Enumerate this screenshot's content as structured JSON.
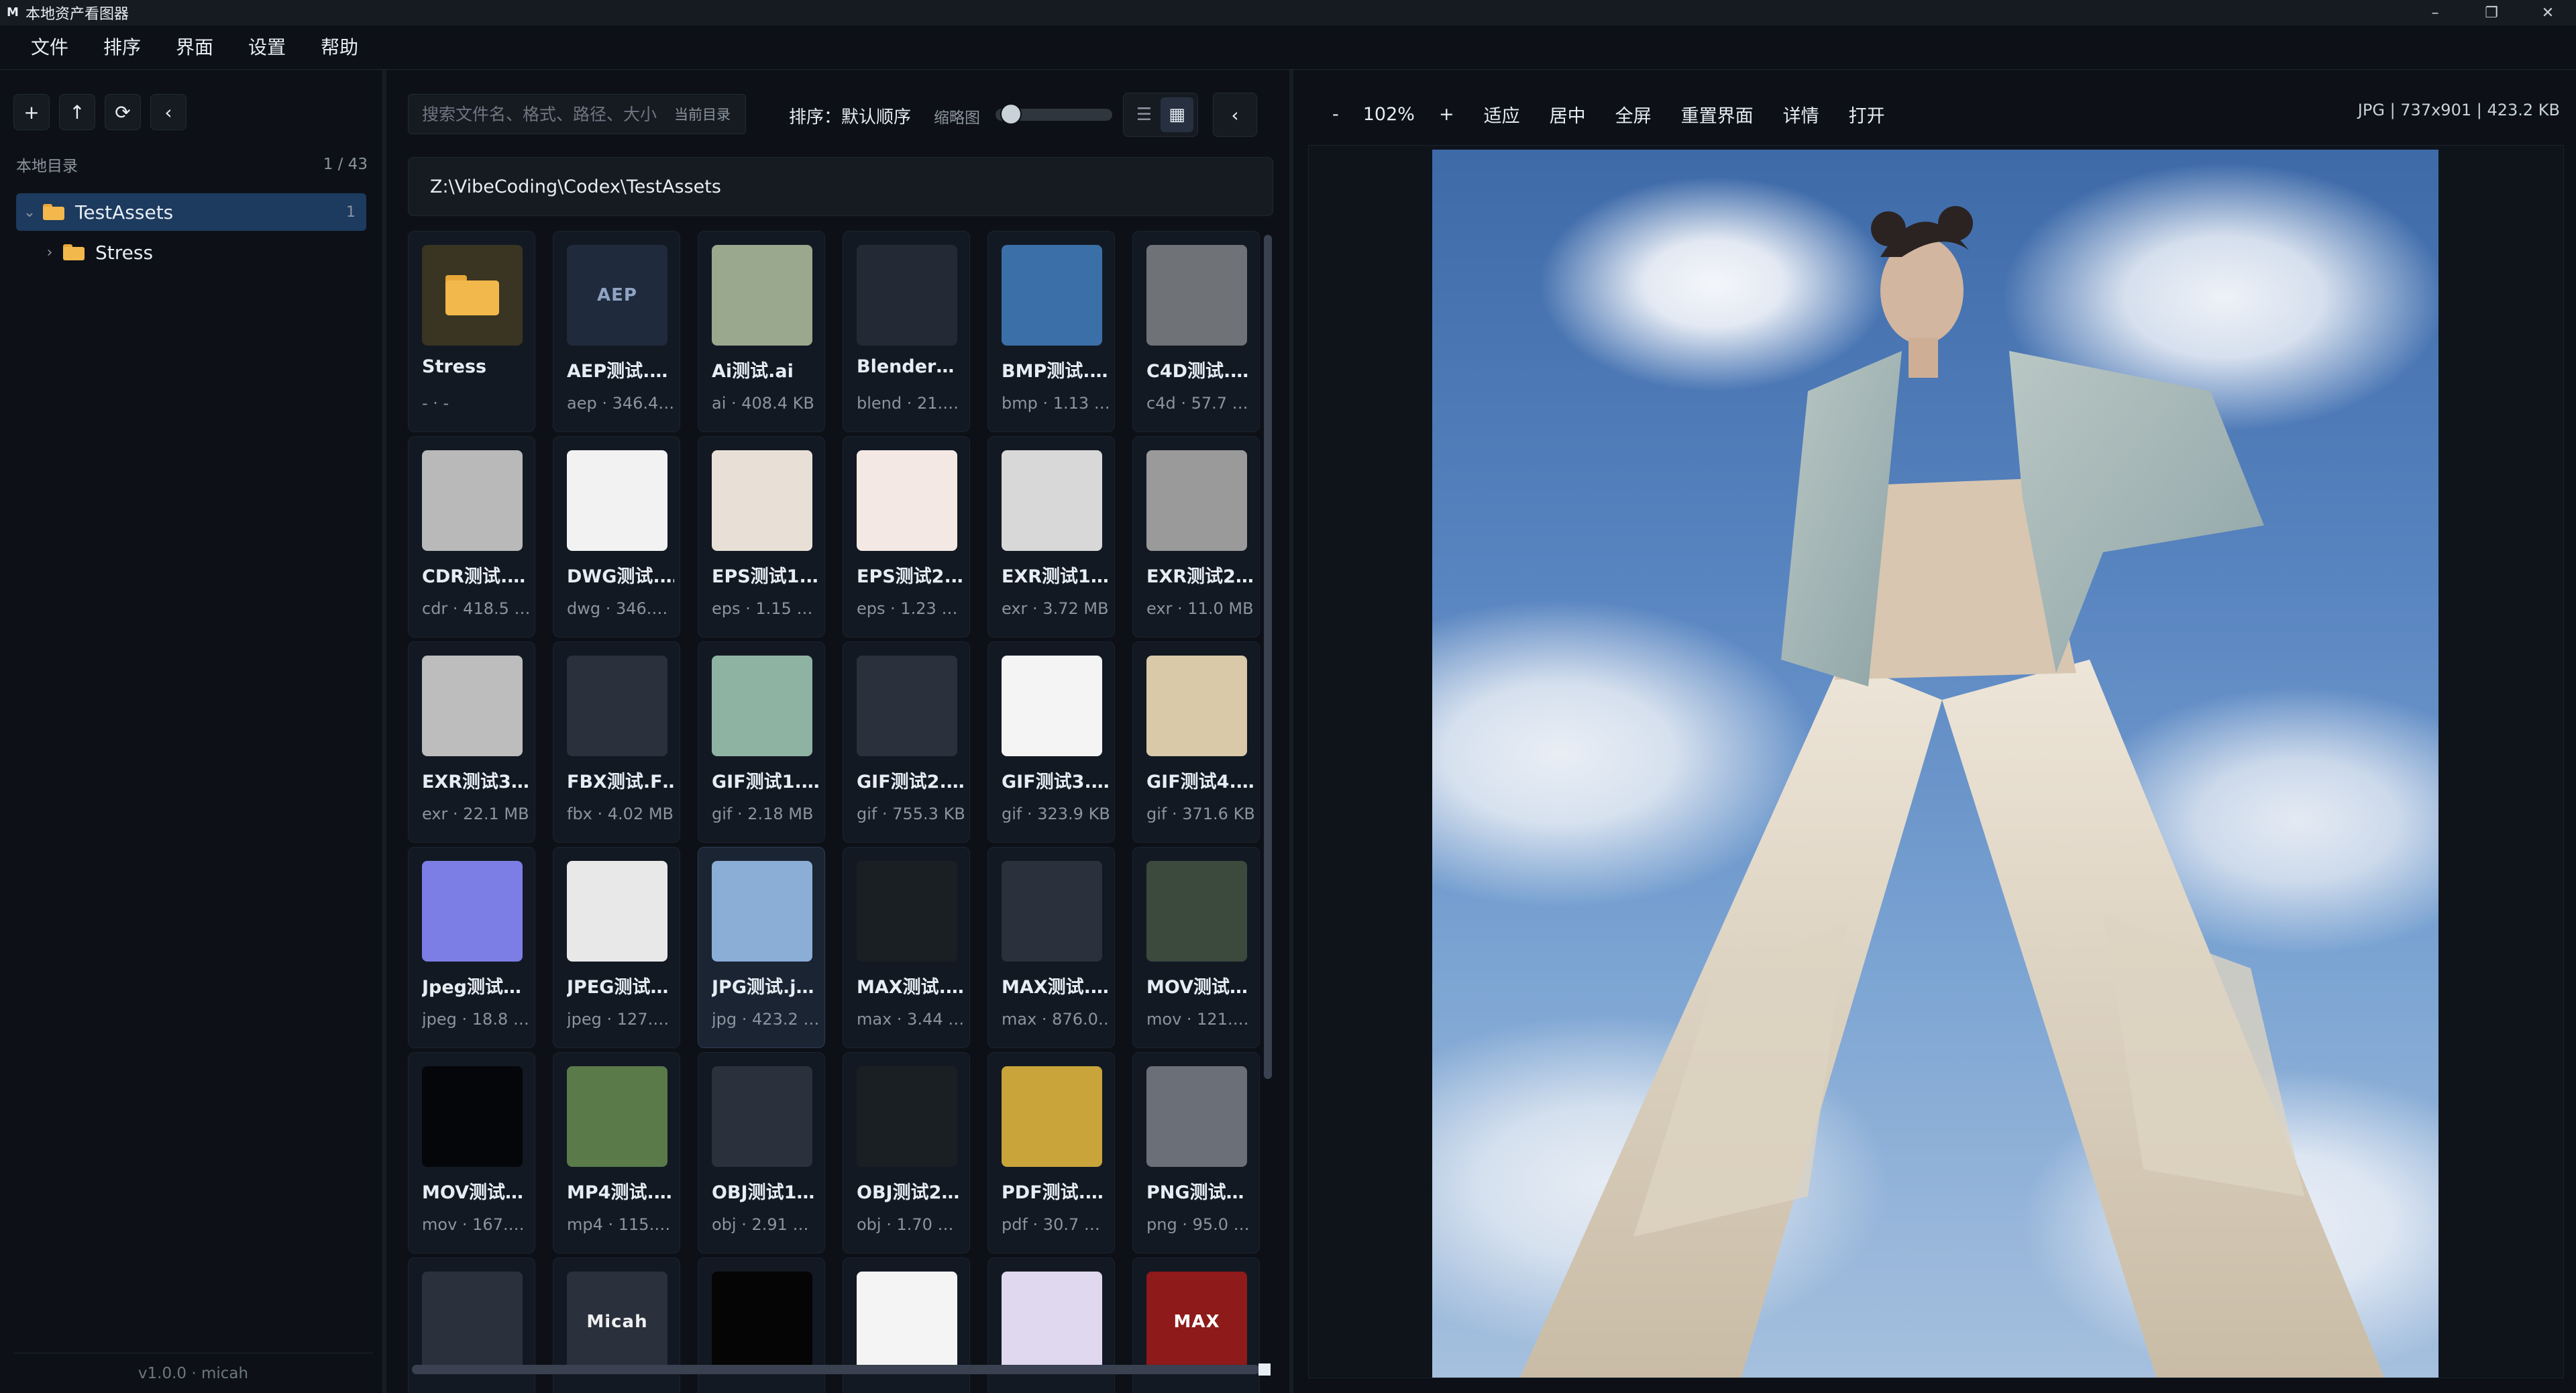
{
  "app": {
    "logo": "M",
    "title": "本地资产看图器"
  },
  "window_controls": {
    "minimize": "–",
    "restore": "❐",
    "close": "✕"
  },
  "menu": [
    "文件",
    "排序",
    "界面",
    "设置",
    "帮助"
  ],
  "sidebar": {
    "tools": [
      "+",
      "↑",
      "⟳",
      "‹"
    ],
    "heading": "本地目录",
    "position": "1 / 43",
    "tree": [
      {
        "label": "TestAssets",
        "count": "1",
        "expanded": true,
        "selected": true,
        "chevron": "⌄"
      },
      {
        "label": "Stress",
        "count": "",
        "expanded": false,
        "selected": false,
        "chevron": "›"
      }
    ],
    "footer": "v1.0.0 · micah"
  },
  "grid_panel": {
    "search_placeholder": "搜索文件名、格式、路径、大小",
    "search_scope": "当前目录",
    "sort_label": "排序：默认顺序",
    "thumb_label": "缩略图",
    "thumb_size_fraction": 0.05,
    "view_list_icon": "☰",
    "view_grid_icon": "▦",
    "collapse_icon": "‹",
    "path": "Z:\\VibeCoding\\Codex\\TestAssets"
  },
  "cards": [
    {
      "name": "Stress",
      "meta": "- · -",
      "kind": "folder"
    },
    {
      "name": "AEP测试.…",
      "meta": "aep · 346.4…",
      "kind": "tag",
      "tag": "AEP",
      "tag_bg": "#1f2a3c",
      "tag_color": "#8fa3c4"
    },
    {
      "name": "Ai测试.ai",
      "meta": "ai · 408.4 KB",
      "kind": "fill",
      "color": "#9aa88e"
    },
    {
      "name": "Blender…",
      "meta": "blend · 21.…",
      "kind": "fill",
      "color": "#232a35"
    },
    {
      "name": "BMP测试.…",
      "meta": "bmp · 1.13 …",
      "kind": "fill",
      "color": "#3b6fa8"
    },
    {
      "name": "C4D测试.…",
      "meta": "c4d · 57.7 …",
      "kind": "fill",
      "color": "#6f7378"
    },
    {
      "name": "CDR测试.…",
      "meta": "cdr · 418.5 …",
      "kind": "fill",
      "color": "#b9b9b9"
    },
    {
      "name": "DWG测试.…",
      "meta": "dwg · 346.…",
      "kind": "fill",
      "color": "#f2f2f2"
    },
    {
      "name": "EPS测试1.…",
      "meta": "eps · 1.15 …",
      "kind": "fill",
      "color": "#e8e0d6"
    },
    {
      "name": "EPS测试2.…",
      "meta": "eps · 1.23 …",
      "kind": "fill",
      "color": "#f3e8e4"
    },
    {
      "name": "EXR测试1…",
      "meta": "exr · 3.72 MB",
      "kind": "fill",
      "color": "#d8d8d8"
    },
    {
      "name": "EXR测试2…",
      "meta": "exr · 11.0 MB",
      "kind": "fill",
      "color": "#9a9a9a"
    },
    {
      "name": "EXR测试3…",
      "meta": "exr · 22.1 MB",
      "kind": "fill",
      "color": "#bdbdbd"
    },
    {
      "name": "FBX测试.F…",
      "meta": "fbx · 4.02 MB",
      "kind": "fill",
      "color": "#2a313d"
    },
    {
      "name": "GIF测试1.…",
      "meta": "gif · 2.18 MB",
      "kind": "fill",
      "color": "#8fb3a3"
    },
    {
      "name": "GIF测试2.…",
      "meta": "gif · 755.3 KB",
      "kind": "fill",
      "color": "#2a313d"
    },
    {
      "name": "GIF测试3.…",
      "meta": "gif · 323.9 KB",
      "kind": "fill",
      "color": "#f4f4f4"
    },
    {
      "name": "GIF测试4.…",
      "meta": "gif · 371.6 KB",
      "kind": "fill",
      "color": "#d9c9a9"
    },
    {
      "name": "Jpeg测试…",
      "meta": "jpeg · 18.8 …",
      "kind": "fill",
      "color": "#7c7ee6"
    },
    {
      "name": "JPEG测试…",
      "meta": "jpeg · 127.…",
      "kind": "fill",
      "color": "#e8e8e8"
    },
    {
      "name": "JPG测试.j…",
      "meta": "jpg · 423.2 …",
      "kind": "fill",
      "color": "#8aaed6",
      "selected": true
    },
    {
      "name": "MAX测试.…",
      "meta": "max · 3.44 …",
      "kind": "fill",
      "color": "#1a1f24"
    },
    {
      "name": "MAX测试.…",
      "meta": "max · 876.0…",
      "kind": "fill",
      "color": "#2a313d"
    },
    {
      "name": "MOV测试…",
      "meta": "mov · 121.…",
      "kind": "fill",
      "color": "#3c4a3e"
    },
    {
      "name": "MOV测试…",
      "meta": "mov · 167.…",
      "kind": "fill",
      "color": "#05060a"
    },
    {
      "name": "MP4测试.…",
      "meta": "mp4 · 115.…",
      "kind": "fill",
      "color": "#5a7a4a"
    },
    {
      "name": "OBJ测试1…",
      "meta": "obj · 2.91 …",
      "kind": "fill",
      "color": "#2a313d"
    },
    {
      "name": "OBJ测试2…",
      "meta": "obj · 1.70 …",
      "kind": "fill",
      "color": "#1a1f24"
    },
    {
      "name": "PDF测试.…",
      "meta": "pdf · 30.7 …",
      "kind": "fill",
      "color": "#c8a43a"
    },
    {
      "name": "PNG测试…",
      "meta": "png · 95.0 …",
      "kind": "fill",
      "color": "#6b6f78"
    },
    {
      "name": "",
      "meta": "",
      "kind": "fill",
      "color": "#2a313d"
    },
    {
      "name": "",
      "meta": "",
      "kind": "tag",
      "tag": "Micah",
      "tag_bg": "#2a313d",
      "tag_color": "#f0f0f0"
    },
    {
      "name": "",
      "meta": "",
      "kind": "fill",
      "color": "#050505"
    },
    {
      "name": "",
      "meta": "",
      "kind": "fill",
      "color": "#f4f4f4"
    },
    {
      "name": "",
      "meta": "",
      "kind": "fill",
      "color": "#e0d8ee"
    },
    {
      "name": "",
      "meta": "",
      "kind": "tag",
      "tag": "MAX",
      "tag_bg": "#8e1a1a",
      "tag_color": "#ffffff"
    }
  ],
  "viewer": {
    "zoom_out": "-",
    "zoom": "102%",
    "zoom_in": "+",
    "actions": [
      "适应",
      "居中",
      "全屏",
      "重置界面",
      "详情",
      "打开"
    ],
    "info": "JPG | 737x901 | 423.2 KB"
  },
  "colors": {
    "background": "#0d1117",
    "panel": "#161b22",
    "selection": "#1d3a5f",
    "folder": "#f2b84b",
    "text": "#e6edf3",
    "muted": "#8b949e"
  }
}
